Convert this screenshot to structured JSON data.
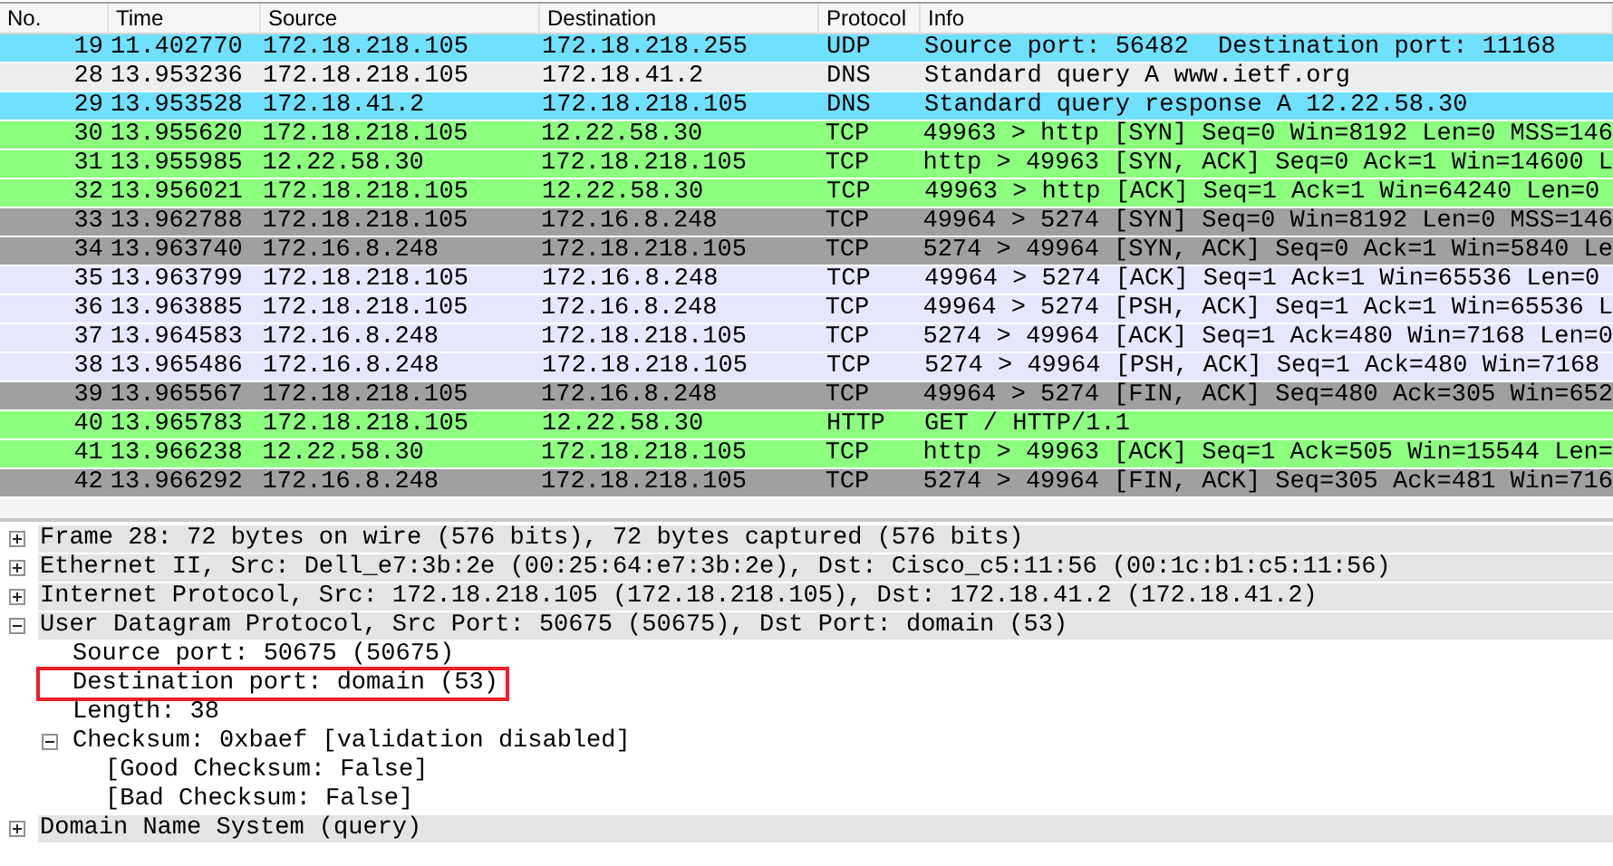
{
  "packet_list": {
    "columns": [
      "No.",
      "Time",
      "Source",
      "Destination",
      "Protocol",
      "Info"
    ],
    "rows": [
      {
        "no": "19",
        "time": "11.402770",
        "source": "172.18.218.105",
        "destination": "172.18.218.255",
        "protocol": "UDP",
        "info": "Source port: 56482  Destination port: 11168",
        "color": "#70e0ff"
      },
      {
        "no": "28",
        "time": "13.953236",
        "source": "172.18.218.105",
        "destination": "172.18.41.2",
        "protocol": "DNS",
        "info": "Standard query A www.ietf.org",
        "color": "#ededed"
      },
      {
        "no": "29",
        "time": "13.953528",
        "source": "172.18.41.2",
        "destination": "172.18.218.105",
        "protocol": "DNS",
        "info": "Standard query response A 12.22.58.30",
        "color": "#70e0ff"
      },
      {
        "no": "30",
        "time": "13.955620",
        "source": "172.18.218.105",
        "destination": "12.22.58.30",
        "protocol": "TCP",
        "info": "49963 > http [SYN] Seq=0 Win=8192 Len=0 MSS=146",
        "color": "#8cff7f"
      },
      {
        "no": "31",
        "time": "13.955985",
        "source": "12.22.58.30",
        "destination": "172.18.218.105",
        "protocol": "TCP",
        "info": "http > 49963 [SYN, ACK] Seq=0 Ack=1 Win=14600 L",
        "color": "#8cff7f"
      },
      {
        "no": "32",
        "time": "13.956021",
        "source": "172.18.218.105",
        "destination": "12.22.58.30",
        "protocol": "TCP",
        "info": "49963 > http [ACK] Seq=1 Ack=1 Win=64240 Len=0",
        "color": "#8cff7f"
      },
      {
        "no": "33",
        "time": "13.962788",
        "source": "172.18.218.105",
        "destination": "172.16.8.248",
        "protocol": "TCP",
        "info": "49964 > 5274 [SYN] Seq=0 Win=8192 Len=0 MSS=146",
        "color": "#a0a0a0"
      },
      {
        "no": "34",
        "time": "13.963740",
        "source": "172.16.8.248",
        "destination": "172.18.218.105",
        "protocol": "TCP",
        "info": "5274 > 49964 [SYN, ACK] Seq=0 Ack=1 Win=5840 Le",
        "color": "#a0a0a0"
      },
      {
        "no": "35",
        "time": "13.963799",
        "source": "172.18.218.105",
        "destination": "172.16.8.248",
        "protocol": "TCP",
        "info": "49964 > 5274 [ACK] Seq=1 Ack=1 Win=65536 Len=0",
        "color": "#e7e6ff"
      },
      {
        "no": "36",
        "time": "13.963885",
        "source": "172.18.218.105",
        "destination": "172.16.8.248",
        "protocol": "TCP",
        "info": "49964 > 5274 [PSH, ACK] Seq=1 Ack=1 Win=65536 L",
        "color": "#e7e6ff"
      },
      {
        "no": "37",
        "time": "13.964583",
        "source": "172.16.8.248",
        "destination": "172.18.218.105",
        "protocol": "TCP",
        "info": "5274 > 49964 [ACK] Seq=1 Ack=480 Win=7168 Len=0",
        "color": "#e7e6ff"
      },
      {
        "no": "38",
        "time": "13.965486",
        "source": "172.16.8.248",
        "destination": "172.18.218.105",
        "protocol": "TCP",
        "info": "5274 > 49964 [PSH, ACK] Seq=1 Ack=480 Win=7168",
        "color": "#e7e6ff"
      },
      {
        "no": "39",
        "time": "13.965567",
        "source": "172.18.218.105",
        "destination": "172.16.8.248",
        "protocol": "TCP",
        "info": "49964 > 5274 [FIN, ACK] Seq=480 Ack=305 Win=652",
        "color": "#a0a0a0"
      },
      {
        "no": "40",
        "time": "13.965783",
        "source": "172.18.218.105",
        "destination": "12.22.58.30",
        "protocol": "HTTP",
        "info": "GET / HTTP/1.1",
        "color": "#8cff7f"
      },
      {
        "no": "41",
        "time": "13.966238",
        "source": "12.22.58.30",
        "destination": "172.18.218.105",
        "protocol": "TCP",
        "info": "http > 49963 [ACK] Seq=1 Ack=505 Win=15544 Len=",
        "color": "#8cff7f"
      },
      {
        "no": "42",
        "time": "13.966292",
        "source": "172.16.8.248",
        "destination": "172.18.218.105",
        "protocol": "TCP",
        "info": "5274 > 49964 [FIN, ACK] Seq=305 Ack=481 Win=716",
        "color": "#a0a0a0"
      }
    ]
  },
  "packet_details": [
    {
      "label": "Frame 28: 72 bytes on wire (576 bits), 72 bytes captured (576 bits)",
      "expanded": false
    },
    {
      "label": "Ethernet II, Src: Dell_e7:3b:2e (00:25:64:e7:3b:2e), Dst: Cisco_c5:11:56 (00:1c:b1:c5:11:56)",
      "expanded": false
    },
    {
      "label": "Internet Protocol, Src: 172.18.218.105 (172.18.218.105), Dst: 172.18.41.2 (172.18.41.2)",
      "expanded": false
    },
    {
      "label": "User Datagram Protocol, Src Port: 50675 (50675), Dst Port: domain (53)",
      "expanded": true,
      "children": [
        {
          "label": "Source port: 50675 (50675)",
          "highlighted": false
        },
        {
          "label": "Destination port: domain (53)",
          "highlighted": true
        },
        {
          "label": "Length: 38",
          "highlighted": false
        },
        {
          "label": "Checksum: 0xbaef [validation disabled]",
          "highlighted": false,
          "expanded": true,
          "children": [
            {
              "label": "[Good Checksum: False]",
              "highlighted": false
            },
            {
              "label": "[Bad Checksum: False]",
              "highlighted": false
            }
          ]
        }
      ]
    },
    {
      "label": "Domain Name System (query)",
      "expanded": false
    }
  ]
}
